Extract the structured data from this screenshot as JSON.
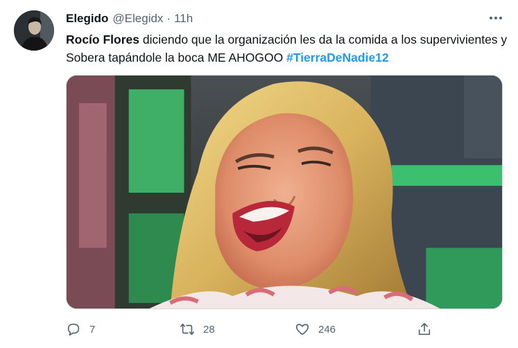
{
  "tweet": {
    "author_name": "Elegido",
    "author_handle": "@Elegidx",
    "separator": "·",
    "time": "11h",
    "text_mention": "Rocío Flores",
    "text_body": " diciendo que la organización les da la comida a los supervivientes y Sobera tapándole la boca ME AHOGOO ",
    "text_hashtag": "#TierraDeNadie12"
  },
  "actions": {
    "reply_count": "7",
    "retweet_count": "28",
    "like_count": "246"
  },
  "icons": {
    "more": "more-horizontal-icon",
    "reply": "reply-icon",
    "retweet": "retweet-icon",
    "like": "heart-icon",
    "share": "share-icon"
  },
  "colors": {
    "text": "#0f1419",
    "secondary": "#536471",
    "link": "#1d9bf0",
    "border": "#cfd9de"
  }
}
